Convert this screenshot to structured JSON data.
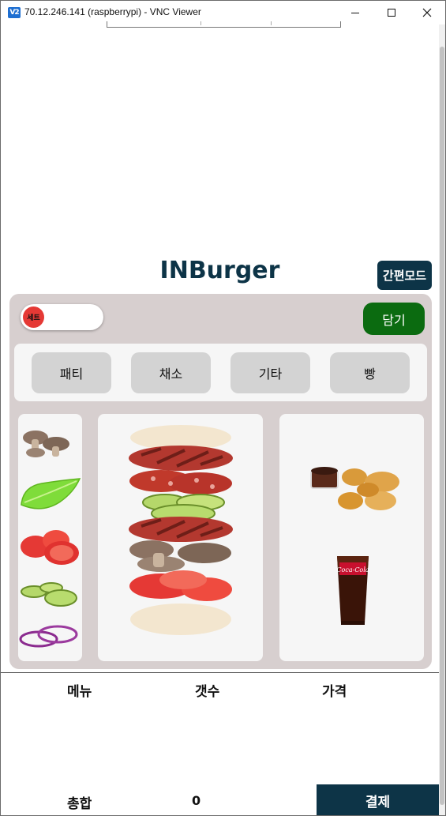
{
  "window": {
    "title": "70.12.246.141 (raspberrypi) - VNC Viewer",
    "icon_label": "V2"
  },
  "app": {
    "title": "INBurger",
    "simple_mode_label": "간편모드",
    "set_toggle_label": "세트",
    "add_label": "담기"
  },
  "categories": [
    "패티",
    "채소",
    "기타",
    "빵"
  ],
  "ingredients": [
    "mushroom",
    "lettuce",
    "tomato",
    "pickle",
    "onion"
  ],
  "burger_layers": [
    "bun-top",
    "patty",
    "salami",
    "pickle",
    "patty",
    "mushroom",
    "tomato",
    "bun-bottom"
  ],
  "sides": [
    "nuggets",
    "cola"
  ],
  "side_text": {
    "cola_brand": "Coca-Cola"
  },
  "table": {
    "headers": [
      "메뉴",
      "갯수",
      "가격"
    ],
    "total_label": "총합",
    "total_value": "0",
    "pay_label": "결제"
  },
  "colors": {
    "brand": "#0d3447",
    "add_button": "#0b6b10",
    "panel": "#d7cfcf",
    "toggle_knob": "#e53935"
  }
}
